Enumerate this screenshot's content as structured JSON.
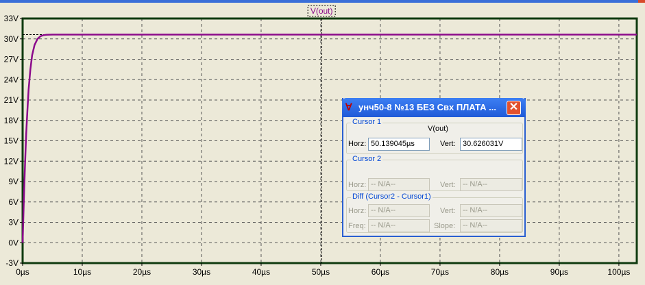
{
  "window": {
    "trace_title": "V(out)"
  },
  "chart_data": {
    "type": "line",
    "title": "V(out)",
    "xlabel": "",
    "ylabel": "",
    "xlim": [
      0,
      103
    ],
    "ylim": [
      -3,
      33
    ],
    "x_ticks": [
      "0µs",
      "10µs",
      "20µs",
      "30µs",
      "40µs",
      "50µs",
      "60µs",
      "70µs",
      "80µs",
      "90µs",
      "100µs"
    ],
    "x_tick_values": [
      0,
      10,
      20,
      30,
      40,
      50,
      60,
      70,
      80,
      90,
      100
    ],
    "y_ticks": [
      "-3V",
      "0V",
      "3V",
      "6V",
      "9V",
      "12V",
      "15V",
      "18V",
      "21V",
      "24V",
      "27V",
      "30V",
      "33V"
    ],
    "y_tick_values": [
      -3,
      0,
      3,
      6,
      9,
      12,
      15,
      18,
      21,
      24,
      27,
      30,
      33
    ],
    "grid": true,
    "series": [
      {
        "color": "#8b0a8b",
        "x": [
          0,
          0.2,
          0.4,
          0.6,
          0.8,
          1.0,
          1.3,
          1.6,
          2.0,
          2.5,
          3.0,
          3.5,
          4.0,
          5.0,
          10,
          20,
          40,
          60,
          80,
          100,
          103
        ],
        "y": [
          0,
          6,
          11.5,
          16,
          19.5,
          22.5,
          25.5,
          27.6,
          29.1,
          30.0,
          30.4,
          30.55,
          30.6,
          30.626,
          30.626,
          30.626,
          30.626,
          30.626,
          30.626,
          30.626,
          30.626
        ]
      }
    ],
    "cursor_x": 50.139045,
    "cursor_y": 30.626031,
    "colors": {
      "background": "#ece9d8",
      "grid": "#555555",
      "frame": "#0f3b0f",
      "trace": "#8b0a8b",
      "cursor": "#000000"
    }
  },
  "dialog": {
    "title": "унч50-8  №13  БЕЗ Свх ПЛАТА ...",
    "close_icon": "close-icon",
    "app_icon": "ltspice-icon",
    "cursor1": {
      "label": "Cursor 1",
      "trace": "V(out)",
      "horz_label": "Horz:",
      "horz_value": "50.139045µs",
      "vert_label": "Vert:",
      "vert_value": "30.626031V"
    },
    "cursor2": {
      "label": "Cursor 2",
      "horz_label": "Horz:",
      "horz_value": "-- N/A--",
      "vert_label": "Vert:",
      "vert_value": "-- N/A--"
    },
    "diff": {
      "label": "Diff (Cursor2 - Cursor1)",
      "horz_label": "Horz:",
      "horz_value": "-- N/A--",
      "vert_label": "Vert:",
      "vert_value": "-- N/A--",
      "freq_label": "Freq:",
      "freq_value": "-- N/A--",
      "slope_label": "Slope:",
      "slope_value": "-- N/A--"
    }
  }
}
